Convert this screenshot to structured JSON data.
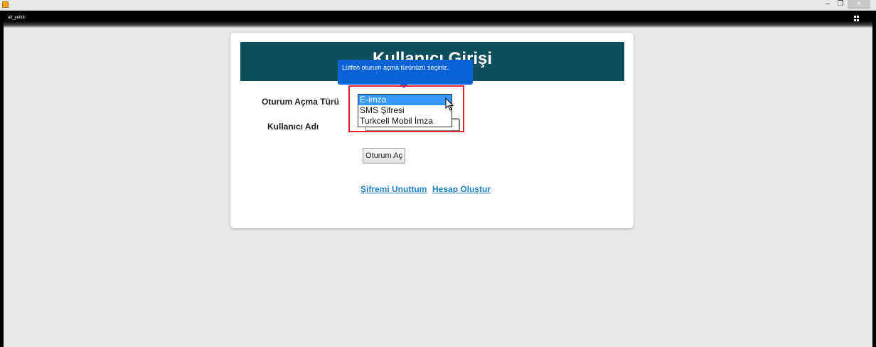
{
  "window": {
    "app_name": "alt_yetkili",
    "minimize_glyph": "–",
    "maximize_glyph": "❐",
    "close_glyph": "×"
  },
  "login": {
    "title": "Kullanıcı Girişi",
    "login_type_label": "Oturum Açma Türü",
    "username_label": "Kullanıcı Adı",
    "username_value": "",
    "login_button": "Oturum Aç",
    "forgot_password_link": "Şifremi Unuttum",
    "create_account_link": "Hesap Oluştur"
  },
  "tooltip": {
    "text": "Lütfen oturum açma türünüzü seçiniz."
  },
  "dropdown": {
    "options": [
      "E-imza",
      "SMS Şifresi",
      "Turkcell Mobil İmza"
    ],
    "selected_index": 0
  },
  "colors": {
    "header_bg": "#0d4f5c",
    "tooltip_bg": "#0a62d6",
    "highlight_border": "#e4202a",
    "link": "#1f7fc4",
    "selected_option": "#3399ff"
  },
  "icons": {
    "app": "app-icon",
    "grid": "grid-icon",
    "cursor": "mouse-pointer-icon"
  }
}
